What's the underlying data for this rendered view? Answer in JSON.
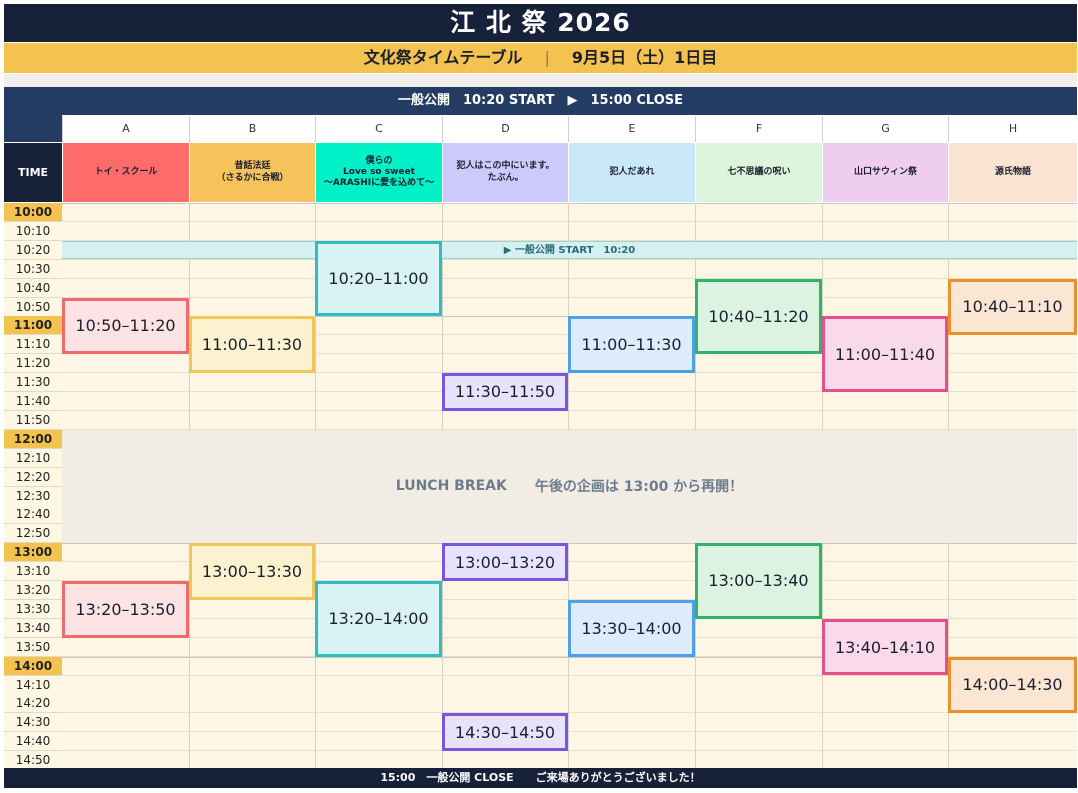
{
  "header": {
    "title": "江 北 祭 2026",
    "subtitle_left": "文化祭タイムテーブル",
    "subtitle_sep": "|",
    "subtitle_right": "9月5日（土）1日目",
    "public_bar": "一般公開　10:20 START　▶　15:00 CLOSE"
  },
  "table": {
    "time_header": "TIME",
    "columns": [
      {
        "letter": "A",
        "name": "トイ・スクール",
        "bg": "#fe6b6b"
      },
      {
        "letter": "B",
        "name": "昔話法廷\n（さるかに合戦）",
        "bg": "#f6c35a"
      },
      {
        "letter": "C",
        "name": "僕らの\nLove so sweet\n〜ARASHIに愛を込めて〜",
        "bg": "#00f0c8"
      },
      {
        "letter": "D",
        "name": "犯人はこの中にいます。\nたぶん。",
        "bg": "#cdc9fb"
      },
      {
        "letter": "E",
        "name": "犯人だあれ",
        "bg": "#c9e8f9"
      },
      {
        "letter": "F",
        "name": "七不思議の呪い",
        "bg": "#dcf5dc"
      },
      {
        "letter": "G",
        "name": "山口サウィン祭",
        "bg": "#efcdef"
      },
      {
        "letter": "H",
        "name": "源氏物語",
        "bg": "#fbe3d4"
      }
    ],
    "times": [
      "10:00",
      "10:10",
      "10:20",
      "10:30",
      "10:40",
      "10:50",
      "11:00",
      "11:10",
      "11:20",
      "11:30",
      "11:40",
      "11:50",
      "12:00",
      "12:10",
      "12:20",
      "12:30",
      "12:40",
      "12:50",
      "13:00",
      "13:10",
      "13:20",
      "13:30",
      "13:40",
      "13:50",
      "14:00",
      "14:10",
      "14:20",
      "14:30",
      "14:40",
      "14:50"
    ],
    "start_band": "▶ 一般公開 START　10:20",
    "lunch_left": "LUNCH BREAK",
    "lunch_right": "午後の企画は 13:00 から再開！"
  },
  "slots": [
    {
      "col": 0,
      "label": "10:50–11:20",
      "start": "10:50",
      "end": "11:20",
      "fill": "#fde3e3",
      "border": "#ef6b6b"
    },
    {
      "col": 1,
      "label": "11:00–11:30",
      "start": "11:00",
      "end": "11:30",
      "fill": "#fdf2d0",
      "border": "#f1c658"
    },
    {
      "col": 2,
      "label": "10:20–11:00",
      "start": "10:20",
      "end": "11:00",
      "fill": "#d9f3f5",
      "border": "#31bcc4"
    },
    {
      "col": 3,
      "label": "11:30–11:50",
      "start": "11:30",
      "end": "11:50",
      "fill": "#e7e3fc",
      "border": "#7a55e0"
    },
    {
      "col": 4,
      "label": "11:00–11:30",
      "start": "11:00",
      "end": "11:30",
      "fill": "#dcecfb",
      "border": "#4f9ee8"
    },
    {
      "col": 5,
      "label": "10:40–11:20",
      "start": "10:40",
      "end": "11:20",
      "fill": "#dcf3e1",
      "border": "#2fb36a"
    },
    {
      "col": 6,
      "label": "11:00–11:40",
      "start": "11:00",
      "end": "11:40",
      "fill": "#fadaea",
      "border": "#e6508a"
    },
    {
      "col": 7,
      "label": "10:40–11:10",
      "start": "10:40",
      "end": "11:10",
      "fill": "#fbe6d4",
      "border": "#ec8f2f"
    },
    {
      "col": 0,
      "label": "13:20–13:50",
      "start": "13:20",
      "end": "13:50",
      "fill": "#fde3e3",
      "border": "#ef6b6b"
    },
    {
      "col": 1,
      "label": "13:00–13:30",
      "start": "13:00",
      "end": "13:30",
      "fill": "#fdf2d0",
      "border": "#f1c658"
    },
    {
      "col": 2,
      "label": "13:20–14:00",
      "start": "13:20",
      "end": "14:00",
      "fill": "#d9f3f5",
      "border": "#31bcc4"
    },
    {
      "col": 3,
      "label": "13:00–13:20",
      "start": "13:00",
      "end": "13:20",
      "fill": "#e7e3fc",
      "border": "#7a55e0"
    },
    {
      "col": 3,
      "label": "14:30–14:50",
      "start": "14:30",
      "end": "14:50",
      "fill": "#e7e3fc",
      "border": "#7a55e0"
    },
    {
      "col": 4,
      "label": "13:30–14:00",
      "start": "13:30",
      "end": "14:00",
      "fill": "#dcecfb",
      "border": "#4f9ee8"
    },
    {
      "col": 5,
      "label": "13:00–13:40",
      "start": "13:00",
      "end": "13:40",
      "fill": "#dcf3e1",
      "border": "#2fb36a"
    },
    {
      "col": 6,
      "label": "13:40–14:10",
      "start": "13:40",
      "end": "14:10",
      "fill": "#fadaea",
      "border": "#e6508a"
    },
    {
      "col": 7,
      "label": "14:00–14:30",
      "start": "14:00",
      "end": "14:30",
      "fill": "#fbe6d4",
      "border": "#ec8f2f"
    }
  ],
  "footer": "15:00　一般公開 CLOSE　　ご来場ありがとうございました！"
}
